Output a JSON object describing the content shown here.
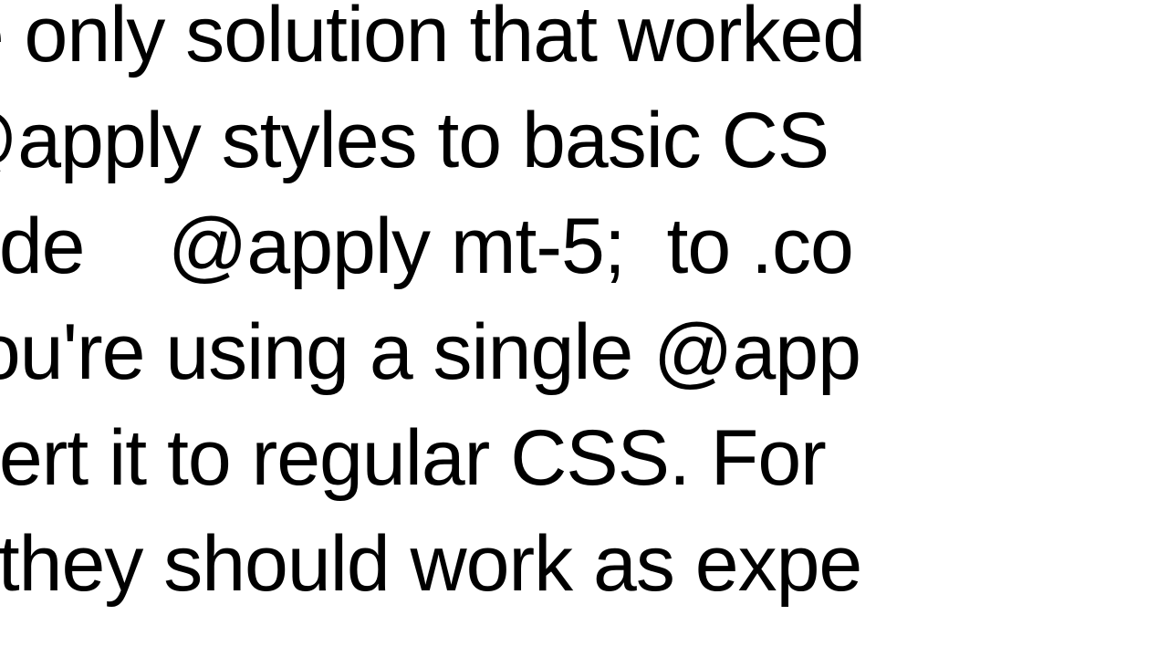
{
  "content": {
    "text": "he only solution that worked\n @apply styles to basic CS\ncode    @apply mt-5;  to .co\n you're using a single @app\nnvert it to regular CSS. For\ns, they should work as expe"
  }
}
